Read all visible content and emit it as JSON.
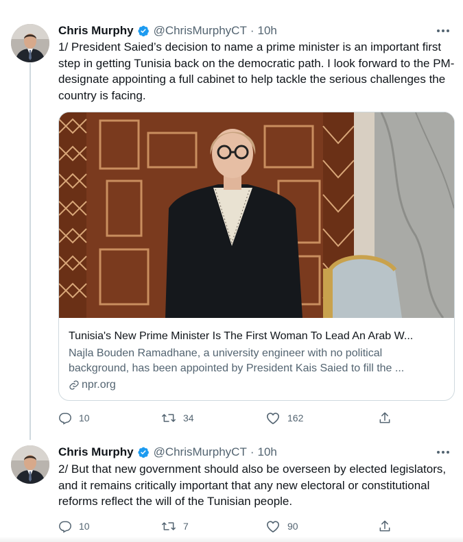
{
  "tweets": [
    {
      "author": {
        "name": "Chris Murphy",
        "handle": "@ChrisMurphyCT",
        "time": "10h",
        "verified": true
      },
      "text": "1/ President Saied’s decision to name a prime minister is an important first step in getting Tunisia back on the democratic path. I look forward to the PM-designate appointing a full cabinet to help tackle the serious challenges the country is facing.",
      "card": {
        "title": "Tunisia's New Prime Minister Is The First Woman To Lead An Arab W...",
        "description": "Najla Bouden Ramadhane, a university engineer with no political background, has been appointed by President Kais Saied to fill the ...",
        "domain": "npr.org"
      },
      "stats": {
        "replies": "10",
        "retweets": "34",
        "likes": "162"
      }
    },
    {
      "author": {
        "name": "Chris Murphy",
        "handle": "@ChrisMurphyCT",
        "time": "10h",
        "verified": true
      },
      "text": "2/ But that new government should also be overseen by elected legislators, and it remains critically important that any new electoral or constitutional reforms reflect the will of the Tunisian people.",
      "stats": {
        "replies": "10",
        "retweets": "7",
        "likes": "90"
      }
    }
  ],
  "ui": {
    "separator": "·",
    "accent": "#1d9bf0",
    "text_color": "#0f1419",
    "muted_color": "#536471"
  }
}
